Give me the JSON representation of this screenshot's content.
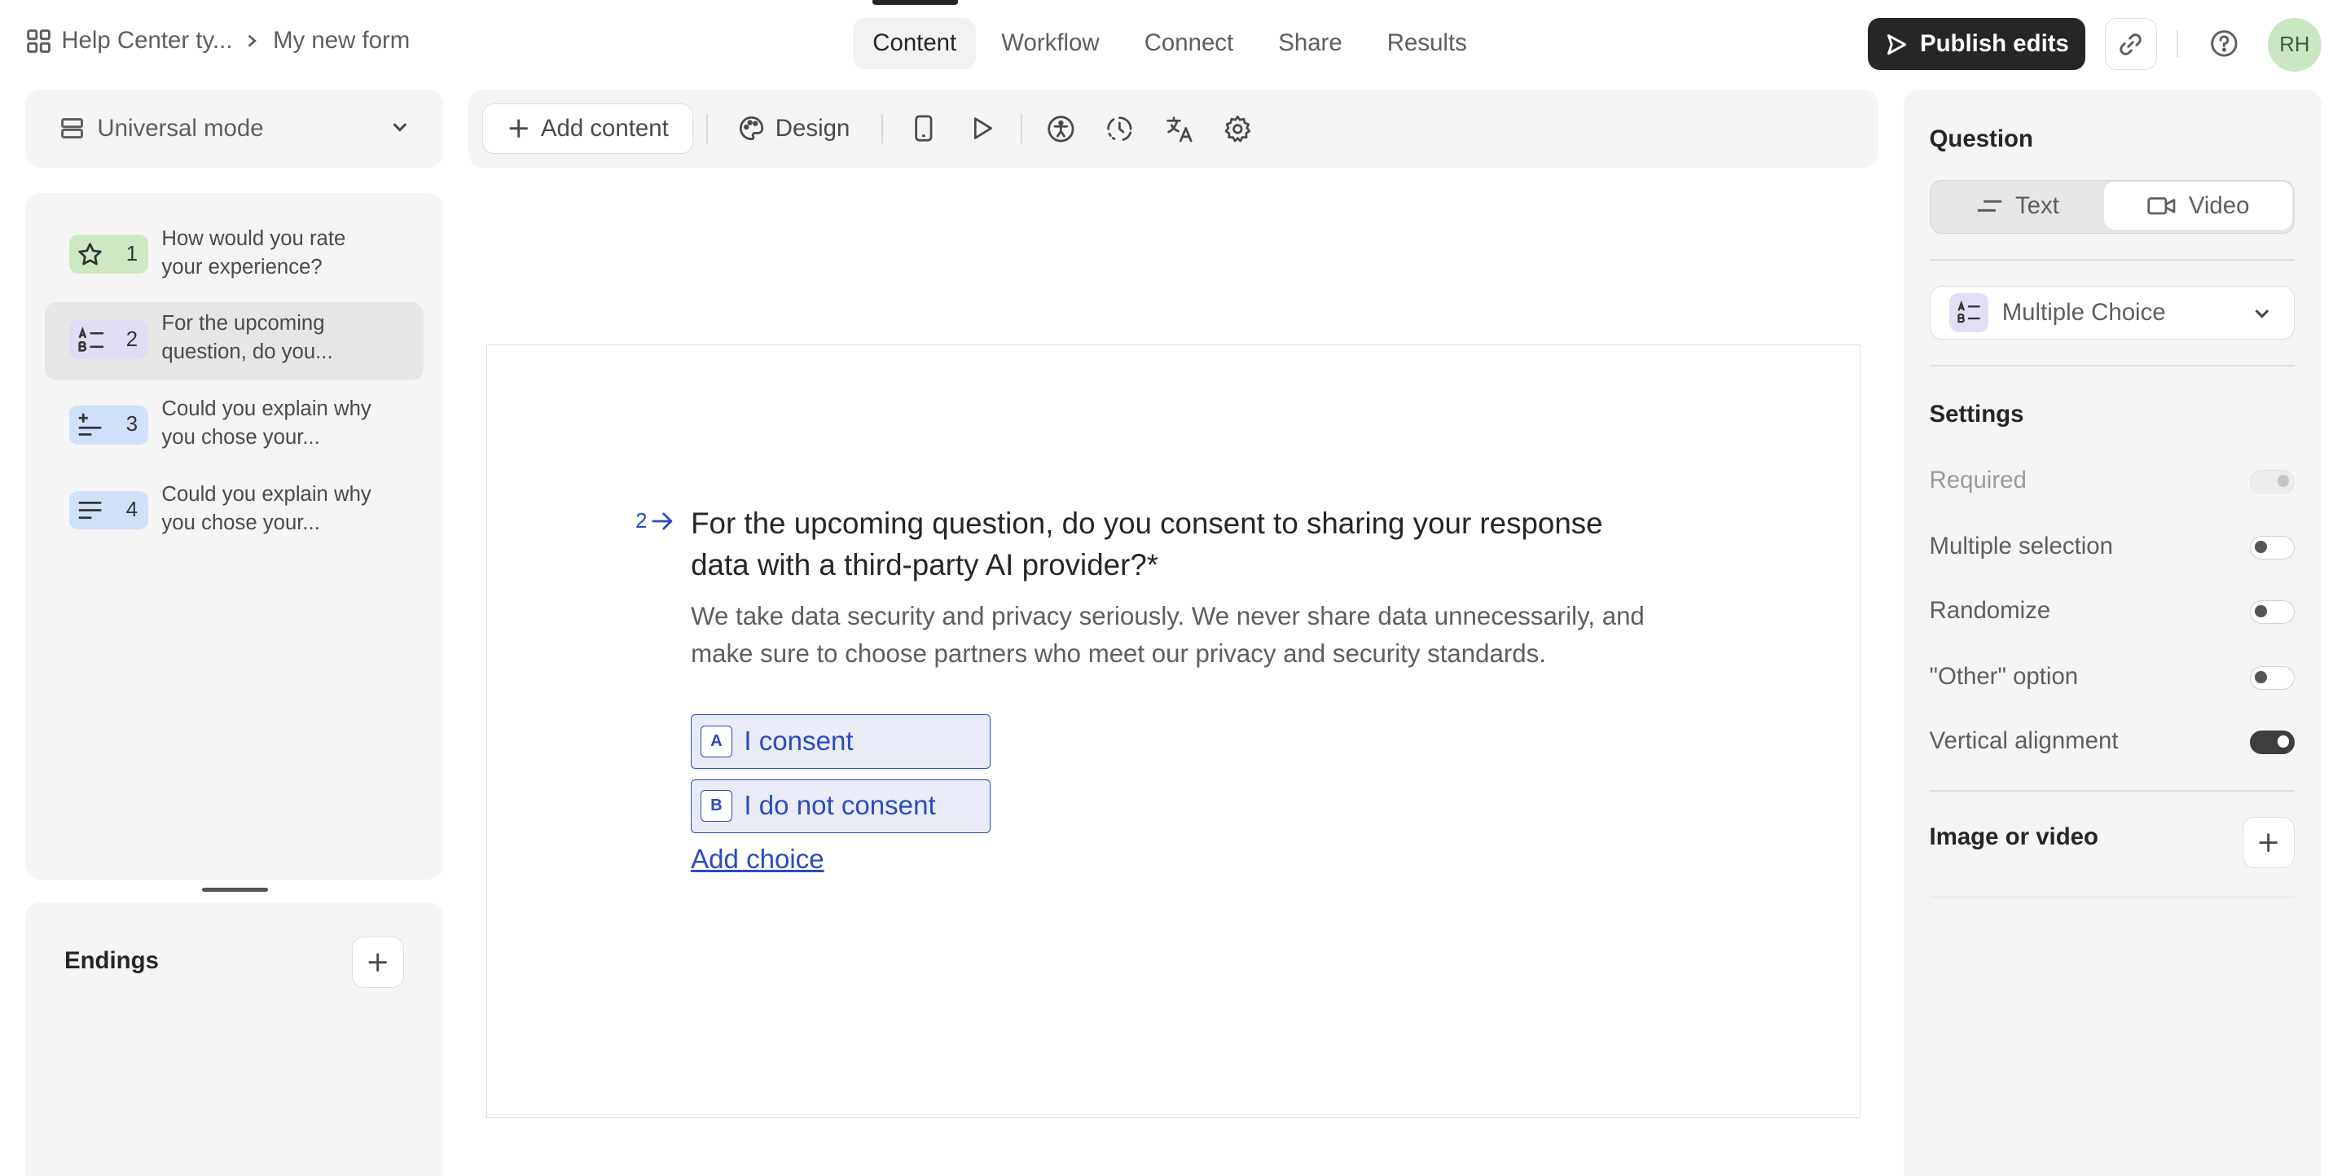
{
  "header": {
    "workspace": "Help Center ty...",
    "form_name": "My new form",
    "tabs": [
      {
        "label": "Content"
      },
      {
        "label": "Workflow"
      },
      {
        "label": "Connect"
      },
      {
        "label": "Share"
      },
      {
        "label": "Results"
      }
    ],
    "publish_label": "Publish edits",
    "avatar_initials": "RH"
  },
  "sidebar": {
    "mode_label": "Universal mode",
    "questions": [
      {
        "num": "1",
        "text": "How would you rate your experience?",
        "badge_color": "#cfe8c4",
        "icon": "star-icon"
      },
      {
        "num": "2",
        "text": "For the upcoming question, do you...",
        "badge_color": "#e1dbf4",
        "icon": "multiple-choice-icon"
      },
      {
        "num": "3",
        "text": "Could you explain why you chose your...",
        "badge_color": "#cfe0f7",
        "icon": "opinion-scale-icon"
      },
      {
        "num": "4",
        "text": "Could you explain why you chose your...",
        "badge_color": "#cfe0f7",
        "icon": "long-text-icon"
      }
    ],
    "endings_label": "Endings"
  },
  "toolbar": {
    "add_content_label": "Add content",
    "design_label": "Design"
  },
  "question": {
    "number": "2",
    "title": "For the upcoming question, do you consent to sharing your response data with a third-party AI provider?*",
    "description": "We take data security and privacy seriously. We never share data unnecessarily, and make sure to choose partners who meet our privacy and security standards.",
    "choices": [
      {
        "key": "A",
        "label": "I consent"
      },
      {
        "key": "B",
        "label": "I do not consent"
      }
    ],
    "add_choice_label": "Add choice"
  },
  "panel": {
    "title": "Question",
    "segment_text": "Text",
    "segment_video": "Video",
    "type_label": "Multiple Choice",
    "settings_title": "Settings",
    "settings": [
      {
        "label": "Required",
        "state": "disabled"
      },
      {
        "label": "Multiple selection",
        "state": "off"
      },
      {
        "label": "Randomize",
        "state": "off"
      },
      {
        "label": "\"Other\" option",
        "state": "off"
      },
      {
        "label": "Vertical alignment",
        "state": "on"
      }
    ],
    "image_video_label": "Image or video"
  },
  "colors": {
    "accent": "#2a4cbf",
    "dark_button": "#262627",
    "panel_bg": "#f5f5f5"
  }
}
